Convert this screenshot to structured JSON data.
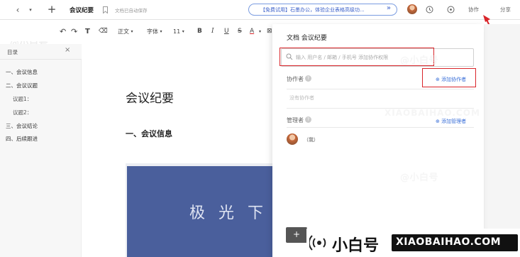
{
  "topbar": {
    "doc_title": "会议纪要",
    "autosave_status": "文档已自动保存",
    "promo_text": "【免费试用】石墨办公，体验企业表格高级功...",
    "collab_label": "协作",
    "share_label": "分享"
  },
  "toolbar": {
    "body_text_label": "正文",
    "font_label": "字体",
    "font_size": "11"
  },
  "outline": {
    "header": "目录",
    "items": [
      "一、会议信息",
      "二、会议议题",
      "议题1：",
      "议题2：",
      "三、会议结论",
      "四、后续跟进"
    ]
  },
  "document": {
    "title": "会议纪要",
    "section_heading": "一、会议信息",
    "image_text": "极 光 下"
  },
  "collab_panel": {
    "title": "文档  会议纪要",
    "search_placeholder": "输入 用户名 / 邮箱 / 手机号 添加协作权限",
    "collaborators_label": "协作者",
    "add_collaborator": "添加协作者",
    "no_collaborators": "没有协作者",
    "managers_label": "管理者",
    "add_manager": "添加管理者",
    "owner_suffix": "（我）"
  },
  "watermarks": {
    "brand": "@小白号",
    "site": "XIAOBAIHAO.COM",
    "small": "关注更多科技资讯"
  },
  "bottom_watermark": {
    "brand": "小白号",
    "site": "XIAOBAIHAO.COM"
  },
  "colors": {
    "highlight": "#d9252a",
    "accent": "#3a6fd8",
    "image_blue": "#4a5f9c"
  }
}
